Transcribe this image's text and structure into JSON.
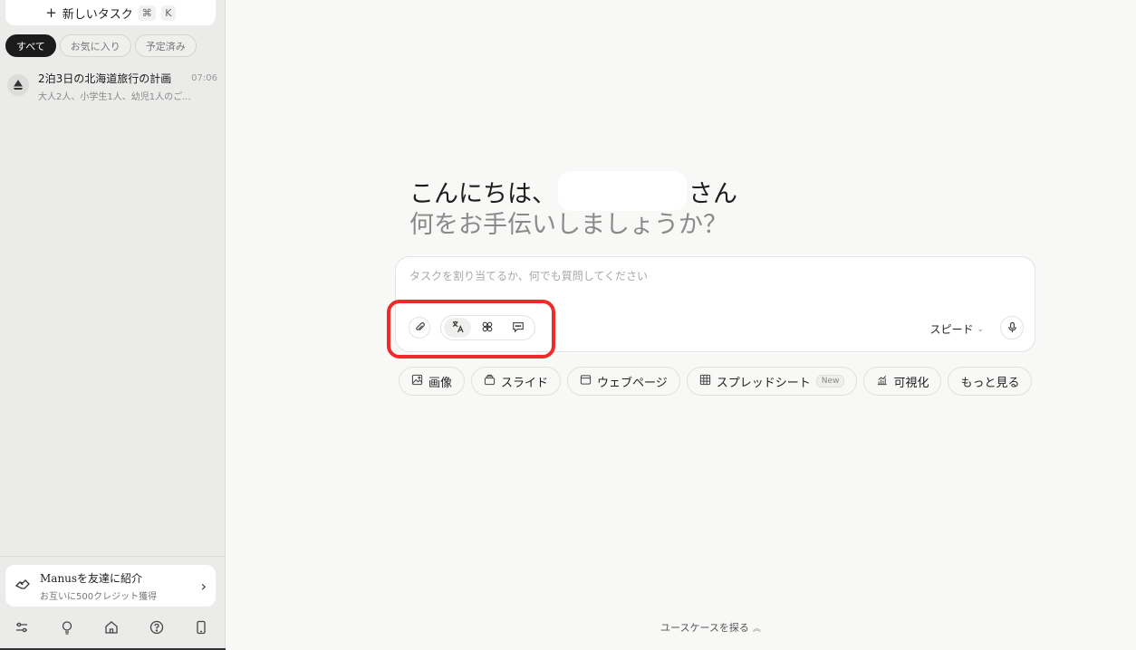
{
  "sidebar": {
    "new_task": {
      "label": "新しいタスク",
      "shortcut_cmd": "⌘",
      "shortcut_key": "K"
    },
    "filters": [
      "すべて",
      "お気に入り",
      "予定済み"
    ],
    "active_filter": "すべて",
    "tasks": [
      {
        "title": "2泊3日の北海道旅行の計画",
        "time": "07:06",
        "subtitle": "大人2人、小学生1人、幼児1人のご..."
      }
    ],
    "invite": {
      "title": "Manusを友達に紹介",
      "subtitle": "お互いに500クレジット獲得"
    },
    "bottom_icons": [
      "sliders-icon",
      "lightbulb-icon",
      "home-icon",
      "help-icon",
      "mobile-icon"
    ]
  },
  "greeting": {
    "prefix": "こんにちは、",
    "suffix": "さん",
    "question": "何をお手伝いしましょうか？"
  },
  "composer": {
    "placeholder": "タスクを割り当てるか、何でも質問してください",
    "value": "",
    "mode_label": "スピード",
    "tools": [
      "translate-icon",
      "connectors-icon",
      "chat-icon"
    ]
  },
  "quick_actions": [
    {
      "icon": "image-icon",
      "label": "画像"
    },
    {
      "icon": "slides-icon",
      "label": "スライド"
    },
    {
      "icon": "webpage-icon",
      "label": "ウェブページ"
    },
    {
      "icon": "spreadsheet-icon",
      "label": "スプレッドシート",
      "badge": "New"
    },
    {
      "icon": "chart-icon",
      "label": "可視化"
    },
    {
      "label": "もっと見る"
    }
  ],
  "footer": {
    "explore_label": "ユースケースを探る"
  },
  "colors": {
    "highlight": "#ee2a2a",
    "active_chip": "#1b1b1b",
    "sidebar_bg": "#ebebea",
    "main_bg": "#f8f8f7"
  }
}
